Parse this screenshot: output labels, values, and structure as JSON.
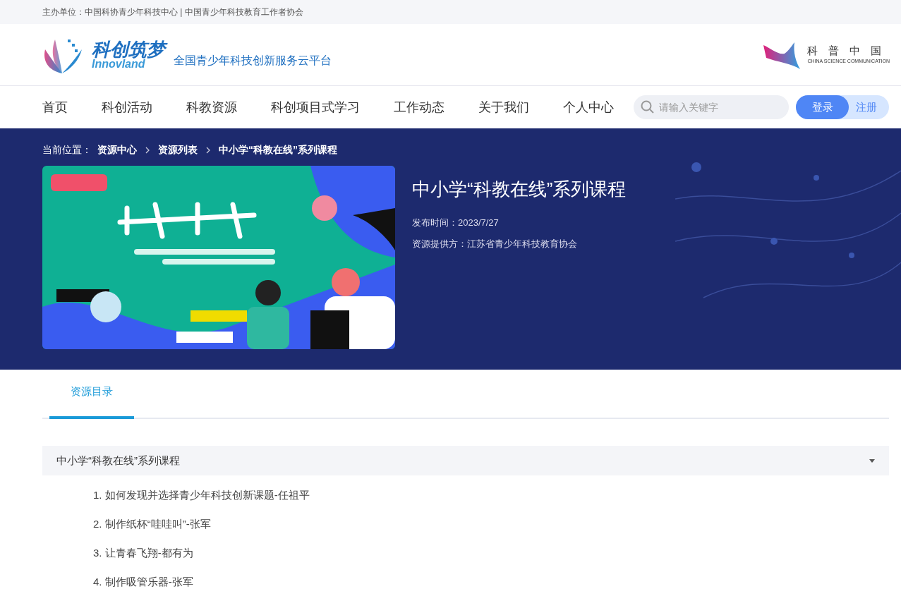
{
  "top_bar": {
    "text": "主办单位：中国科协青少年科技中心 | 中国青少年科技教育工作者协会"
  },
  "header": {
    "logo_title": "科创筑梦",
    "logo_subtitle": "Innovland",
    "slogan": "全国青少年科技创新服务云平台",
    "partner_title": "科　普　中　国",
    "partner_subtitle": "CHINA SCIENCE COMMUNICATION"
  },
  "nav": {
    "items": [
      {
        "label": "首页",
        "selected": false
      },
      {
        "label": "科创活动",
        "selected": false
      },
      {
        "label": "科教资源",
        "selected": false
      },
      {
        "label": "科创项目式学习",
        "selected": false
      },
      {
        "label": "工作动态",
        "selected": false
      },
      {
        "label": "关于我们",
        "selected": false
      },
      {
        "label": "个人中心",
        "selected": false
      }
    ],
    "search": {
      "placeholder": "请输入关键字"
    },
    "login": "登录",
    "register": "注册"
  },
  "breadcrumb": {
    "label": "当前位置：",
    "items": [
      "资源中心",
      "资源列表",
      "中小学“科教在线”系列课程"
    ]
  },
  "resource": {
    "title": "中小学“科教在线”系列课程",
    "published": "发布时间：2023/7/27",
    "provider": "资源提供方：江苏省青少年科技教育协会"
  },
  "tabs": [
    {
      "label": "资源目录",
      "selected": true
    }
  ],
  "catalog": {
    "title": "中小学“科教在线”系列课程",
    "expanded": true,
    "items": [
      "1. 如何发现并选择青少年科技创新课题-任祖平",
      "2. 制作纸杯“哇哇叫”-张军",
      "3. 让青春飞翔-都有为",
      "4. 制作吸管乐器-张军"
    ]
  }
}
